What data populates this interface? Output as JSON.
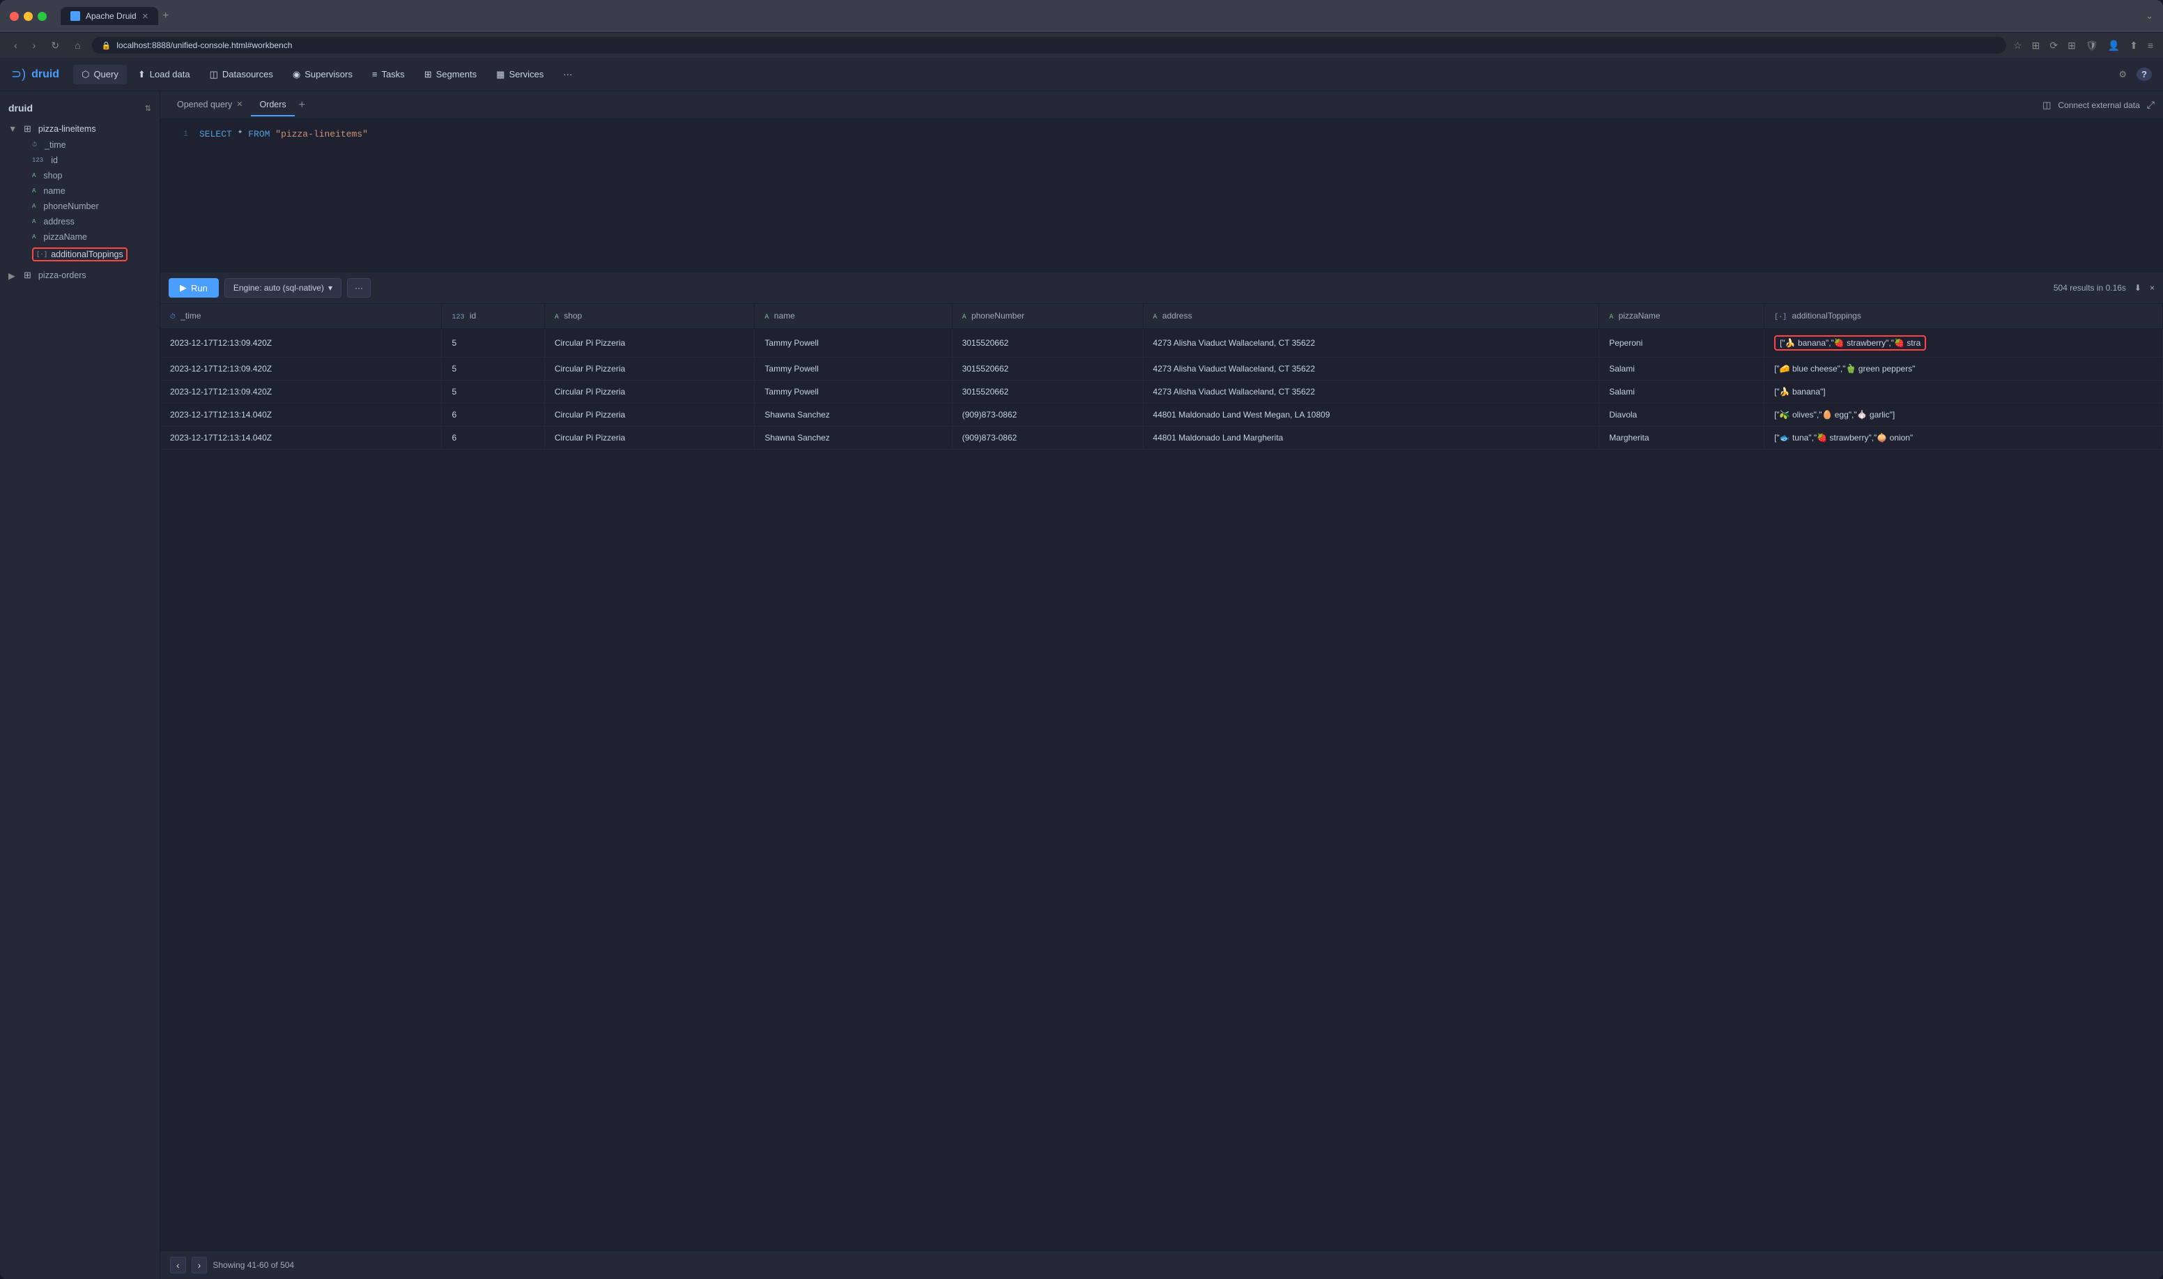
{
  "browser": {
    "tab_label": "Apache Druid",
    "url": "localhost:8888/unified-console.html#workbench",
    "new_tab_icon": "+",
    "dropdown_icon": "⌄"
  },
  "header": {
    "logo_text": "druid",
    "nav_items": [
      {
        "id": "query",
        "label": "Query",
        "icon": "⬡",
        "active": true
      },
      {
        "id": "load-data",
        "label": "Load data",
        "icon": "⬆",
        "active": false
      },
      {
        "id": "datasources",
        "label": "Datasources",
        "icon": "◫",
        "active": false
      },
      {
        "id": "supervisors",
        "label": "Supervisors",
        "icon": "◉",
        "active": false
      },
      {
        "id": "tasks",
        "label": "Tasks",
        "icon": "≡",
        "active": false
      },
      {
        "id": "segments",
        "label": "Segments",
        "icon": "⊞",
        "active": false
      },
      {
        "id": "services",
        "label": "Services",
        "icon": "▦",
        "active": false
      },
      {
        "id": "more",
        "label": "···",
        "active": false
      }
    ],
    "settings_icon": "⚙",
    "help_icon": "?"
  },
  "sidebar": {
    "title": "druid",
    "datasources": [
      {
        "id": "pizza-lineitems",
        "label": "pizza-lineitems",
        "expanded": true,
        "columns": [
          {
            "name": "_time",
            "type": "clock",
            "type_label": "⏱"
          },
          {
            "name": "id",
            "type": "number",
            "type_label": "123"
          },
          {
            "name": "shop",
            "type": "string",
            "type_label": "A"
          },
          {
            "name": "name",
            "type": "string",
            "type_label": "A"
          },
          {
            "name": "phoneNumber",
            "type": "string",
            "type_label": "A"
          },
          {
            "name": "address",
            "type": "string",
            "type_label": "A"
          },
          {
            "name": "pizzaName",
            "type": "string",
            "type_label": "A"
          },
          {
            "name": "additionalToppings",
            "type": "array",
            "type_label": "[·]",
            "highlighted": true
          }
        ]
      },
      {
        "id": "pizza-orders",
        "label": "pizza-orders",
        "expanded": false,
        "columns": []
      }
    ]
  },
  "workbench": {
    "tabs": [
      {
        "id": "opened-query",
        "label": "Opened query",
        "active": false,
        "closable": true
      },
      {
        "id": "orders",
        "label": "Orders",
        "active": true,
        "closable": false
      }
    ],
    "add_tab_label": "+",
    "connect_label": "Connect external data",
    "collapse_icon": "⤢"
  },
  "editor": {
    "lines": [
      {
        "number": "1",
        "code": "SELECT * FROM \"pizza-lineitems\""
      }
    ]
  },
  "toolbar": {
    "run_label": "Run",
    "engine_label": "Engine: auto (sql-native)",
    "more_label": "···",
    "results_summary": "504 results in 0.16s",
    "download_icon": "⬇",
    "close_icon": "×"
  },
  "table": {
    "columns": [
      {
        "id": "time",
        "type_label": "⏱",
        "label": "_time"
      },
      {
        "id": "id",
        "type_label": "123",
        "label": "id"
      },
      {
        "id": "shop",
        "type_label": "A",
        "label": "shop"
      },
      {
        "id": "name",
        "type_label": "A",
        "label": "name"
      },
      {
        "id": "phoneNumber",
        "type_label": "A",
        "label": "phoneNumber"
      },
      {
        "id": "address",
        "type_label": "A",
        "label": "address"
      },
      {
        "id": "pizzaName",
        "type_label": "A",
        "label": "pizzaName"
      },
      {
        "id": "additionalToppings",
        "type_label": "[·]",
        "label": "additionalToppings",
        "highlighted": true
      }
    ],
    "rows": [
      {
        "time": "2023-12-17T12:13:09.420Z",
        "id": "5",
        "shop": "Circular Pi Pizzeria",
        "name": "Tammy Powell",
        "phoneNumber": "3015520662",
        "address": "4273 Alisha Viaduct Wallaceland, CT 35622",
        "pizzaName": "Peperoni",
        "additionalToppings": "[\"🍌 banana\",\"🍓 strawberry\",\"🍓 stra",
        "additionalToppings_highlighted": true
      },
      {
        "time": "2023-12-17T12:13:09.420Z",
        "id": "5",
        "shop": "Circular Pi Pizzeria",
        "name": "Tammy Powell",
        "phoneNumber": "3015520662",
        "address": "4273 Alisha Viaduct Wallaceland, CT 35622",
        "pizzaName": "Salami",
        "additionalToppings": "[\"🧀 blue cheese\",\"🫑 green peppers\"",
        "additionalToppings_highlighted": false
      },
      {
        "time": "2023-12-17T12:13:09.420Z",
        "id": "5",
        "shop": "Circular Pi Pizzeria",
        "name": "Tammy Powell",
        "phoneNumber": "3015520662",
        "address": "4273 Alisha Viaduct Wallaceland, CT 35622",
        "pizzaName": "Salami",
        "additionalToppings": "[\"🍌 banana\"]",
        "additionalToppings_highlighted": false
      },
      {
        "time": "2023-12-17T12:13:14.040Z",
        "id": "6",
        "shop": "Circular Pi Pizzeria",
        "name": "Shawna Sanchez",
        "phoneNumber": "(909)873-0862",
        "address": "44801 Maldonado Land West Megan, LA 10809",
        "pizzaName": "Diavola",
        "additionalToppings": "[\"🫒 olives\",\"🥚 egg\",\"🧄 garlic\"]",
        "additionalToppings_highlighted": false
      },
      {
        "time": "2023-12-17T12:13:14.040Z",
        "id": "6",
        "shop": "Circular Pi Pizzeria",
        "name": "Shawna Sanchez",
        "phoneNumber": "(909)873-0862",
        "address": "44801 Maldonado Land Margherita",
        "pizzaName": "Margherita",
        "additionalToppings": "[\"🐟 tuna\",\"🍓 strawberry\",\"🧅 onion\"",
        "additionalToppings_highlighted": false
      }
    ]
  },
  "pagination": {
    "prev_icon": "‹",
    "next_icon": "›",
    "label": "Showing 41-60 of 504"
  }
}
